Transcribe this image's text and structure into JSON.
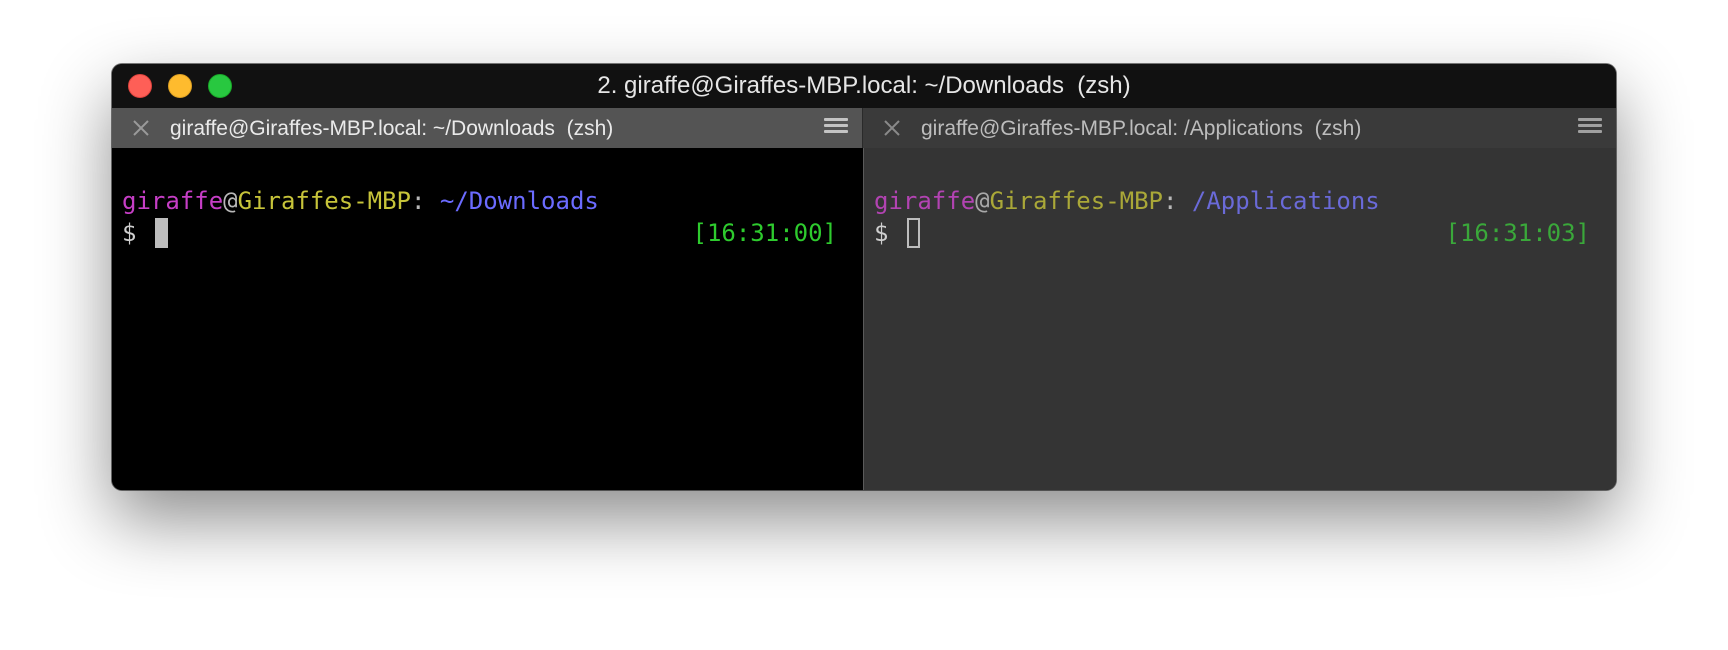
{
  "window": {
    "title": "2. giraffe@Giraffes-MBP.local: ~/Downloads  (zsh)"
  },
  "tabs": [
    {
      "label": "giraffe@Giraffes-MBP.local: ~/Downloads  (zsh)",
      "close_icon": "close-icon",
      "menu_icon": "hamburger-menu-icon",
      "active": true
    },
    {
      "label": "giraffe@Giraffes-MBP.local: /Applications  (zsh)",
      "close_icon": "close-icon",
      "menu_icon": "hamburger-menu-icon",
      "active": false
    }
  ],
  "panes": [
    {
      "user": "giraffe",
      "at": "@",
      "host": "Giraffes-MBP",
      "colon": ": ",
      "path": "~/Downloads",
      "prompt": "$",
      "time": "[16:31:00]"
    },
    {
      "user": "giraffe",
      "at": "@",
      "host": "Giraffes-MBP",
      "colon": ": ",
      "path": "/Applications",
      "prompt": "$",
      "time": "[16:31:03]"
    }
  ],
  "colors": {
    "close": "#fe5f57",
    "minimize": "#febb2e",
    "maximize": "#28c840",
    "user": "#c63ec6",
    "host": "#c7c43a",
    "path": "#6b6bff",
    "time": "#2ecb2e"
  }
}
